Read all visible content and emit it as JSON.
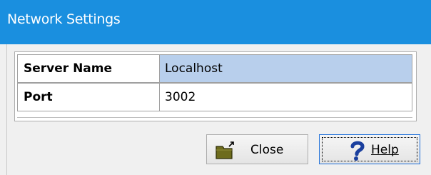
{
  "window": {
    "title": "Network Settings"
  },
  "grid": {
    "rows": [
      {
        "label": "Server Name",
        "value": "Localhost"
      },
      {
        "label": "Port",
        "value": "3002"
      }
    ]
  },
  "buttons": {
    "close": {
      "label": "Close",
      "icon": "folder-exit-icon"
    },
    "help": {
      "label": "Help",
      "icon": "question-mark-icon"
    }
  },
  "colors": {
    "titlebar": "#1a8fdf",
    "selected_row": "#b8cfec",
    "help_icon": "#1a3f9e",
    "folder_icon": "#6d6b1c"
  }
}
